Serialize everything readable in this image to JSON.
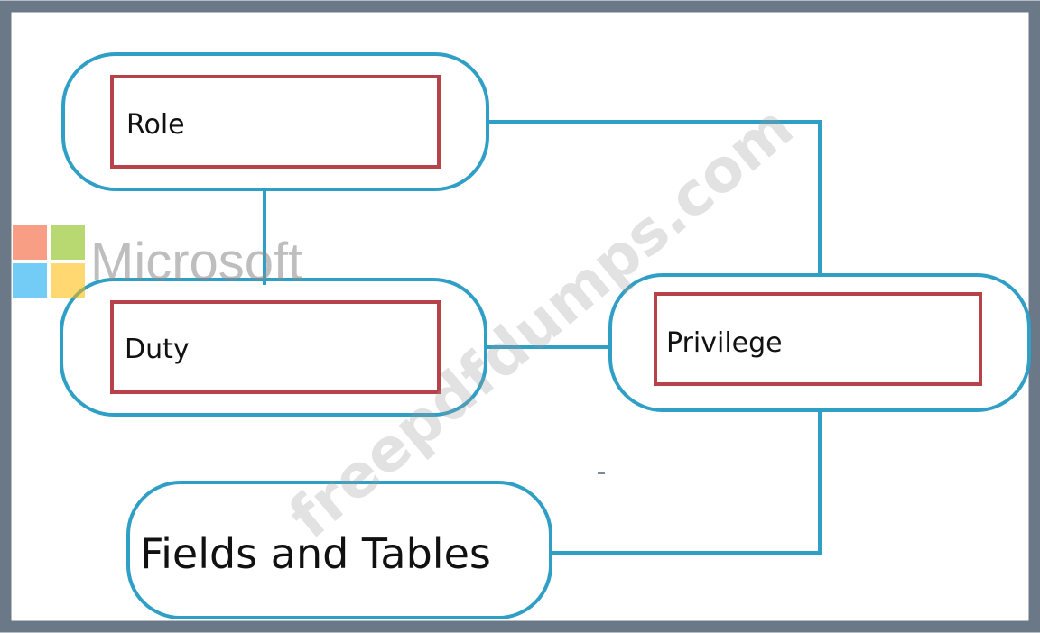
{
  "nodes": {
    "role": {
      "label": "Role"
    },
    "duty": {
      "label": "Duty"
    },
    "privilege": {
      "label": "Privilege"
    },
    "fields": {
      "label": "Fields and Tables"
    }
  },
  "watermark": {
    "brand": "Microsoft",
    "site": "freepdfdumps.com"
  },
  "colors": {
    "frame": "#6b7888",
    "pill": "#2f9fc6",
    "inner_box": "#b8424a",
    "connector": "#2f9fc6",
    "logo_red": "#f25022",
    "logo_green": "#7fba00",
    "logo_blue": "#00a4ef",
    "logo_yellow": "#ffb900"
  }
}
